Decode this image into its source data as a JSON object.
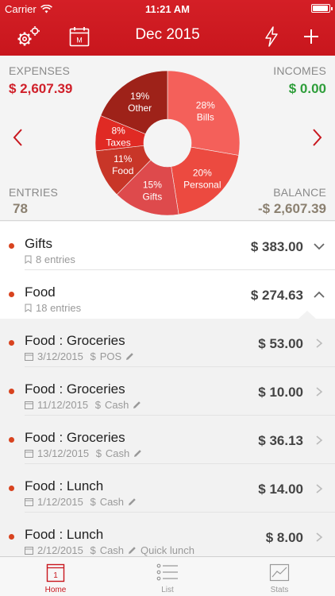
{
  "status": {
    "carrier": "Carrier",
    "time": "11:21 AM"
  },
  "nav": {
    "title": "Dec 2015",
    "calendar_letter": "M"
  },
  "summary": {
    "expenses_label": "EXPENSES",
    "expenses_value": "$ 2,607.39",
    "incomes_label": "INCOMES",
    "incomes_value": "$ 0.00",
    "entries_label": "ENTRIES",
    "entries_value": "78",
    "balance_label": "BALANCE",
    "balance_value": "-$ 2,607.39"
  },
  "chart_data": {
    "type": "pie",
    "slices": [
      {
        "name": "Bills",
        "percent": 28,
        "label": "28%",
        "color": "#f4605a"
      },
      {
        "name": "Personal",
        "percent": 20,
        "label": "20%",
        "color": "#ec4a40"
      },
      {
        "name": "Gifts",
        "percent": 15,
        "label": "15%",
        "color": "#de4a4c"
      },
      {
        "name": "Food",
        "percent": 11,
        "label": "11%",
        "color": "#c83628"
      },
      {
        "name": "Taxes",
        "percent": 8,
        "label": "8%",
        "color": "#e02a24"
      },
      {
        "name": "Other",
        "percent": 19,
        "label": "19%",
        "color": "#9e2219"
      }
    ]
  },
  "categories": [
    {
      "name": "Gifts",
      "entries": "8 entries",
      "amount": "$ 383.00",
      "expanded": false
    },
    {
      "name": "Food",
      "entries": "18 entries",
      "amount": "$ 274.63",
      "expanded": true
    }
  ],
  "transactions": [
    {
      "name": "Food : Groceries",
      "date": "3/12/2015",
      "method": "POS",
      "note": "",
      "amount": "$ 53.00"
    },
    {
      "name": "Food : Groceries",
      "date": "11/12/2015",
      "method": "Cash",
      "note": "",
      "amount": "$ 10.00"
    },
    {
      "name": "Food : Groceries",
      "date": "13/12/2015",
      "method": "Cash",
      "note": "",
      "amount": "$ 36.13"
    },
    {
      "name": "Food : Lunch",
      "date": "1/12/2015",
      "method": "Cash",
      "note": "",
      "amount": "$ 14.00"
    },
    {
      "name": "Food : Lunch",
      "date": "2/12/2015",
      "method": "Cash",
      "note": "Quick lunch",
      "amount": "$ 8.00"
    }
  ],
  "tabs": [
    {
      "label": "Home",
      "active": true,
      "badge": "1"
    },
    {
      "label": "List",
      "active": false
    },
    {
      "label": "Stats",
      "active": false
    }
  ],
  "colors": {
    "brand": "#c8161d",
    "expense": "#d0202a",
    "income": "#2e9e3a",
    "muted": "#8b8070",
    "dot": "#d8431f"
  }
}
